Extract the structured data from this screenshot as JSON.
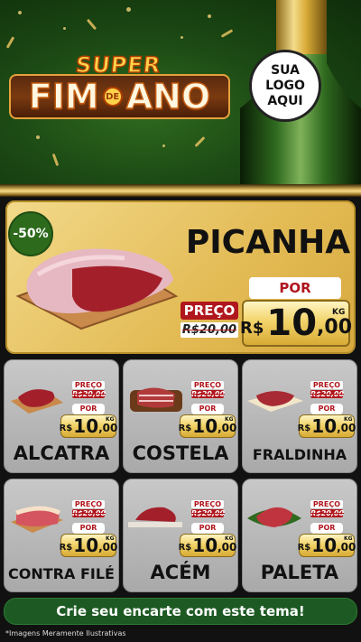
{
  "header": {
    "title_super": "SUPER",
    "title_fim": "FIM",
    "title_de": "DE",
    "title_ano": "ANO",
    "logo_lines": [
      "SUA",
      "LOGO",
      "AQUI"
    ]
  },
  "featured": {
    "discount": "-50%",
    "name": "PICANHA",
    "preco_label": "PREÇO",
    "old_price": "R$20,00",
    "por_label": "POR",
    "currency": "R$",
    "price_int": "10",
    "price_dec": ",00",
    "unit": "KG"
  },
  "products": [
    {
      "name": "ALCATRA",
      "preco_label": "PREÇO",
      "old_price": "R$20,00",
      "por_label": "POR",
      "currency": "R$",
      "price_int": "10",
      "price_dec": ",00",
      "unit": "KG"
    },
    {
      "name": "COSTELA",
      "preco_label": "PREÇO",
      "old_price": "R$20,00",
      "por_label": "POR",
      "currency": "R$",
      "price_int": "10",
      "price_dec": ",00",
      "unit": "KG"
    },
    {
      "name": "FRALDINHA",
      "preco_label": "PREÇO",
      "old_price": "R$20,00",
      "por_label": "POR",
      "currency": "R$",
      "price_int": "10",
      "price_dec": ",00",
      "unit": "KG"
    },
    {
      "name": "CONTRA FILÉ",
      "preco_label": "PREÇO",
      "old_price": "R$20,00",
      "por_label": "POR",
      "currency": "R$",
      "price_int": "10",
      "price_dec": ",00",
      "unit": "KG"
    },
    {
      "name": "ACÉM",
      "preco_label": "PREÇO",
      "old_price": "R$20,00",
      "por_label": "POR",
      "currency": "R$",
      "price_int": "10",
      "price_dec": ",00",
      "unit": "KG"
    },
    {
      "name": "PALETA",
      "preco_label": "PREÇO",
      "old_price": "R$20,00",
      "por_label": "POR",
      "currency": "R$",
      "price_int": "10",
      "price_dec": ",00",
      "unit": "KG"
    }
  ],
  "cta": "Crie seu encarte com este tema!",
  "footnote": "*Imagens Meramente Ilustrativas",
  "colors": {
    "green": "#1d5a23",
    "gold": "#e3bb55",
    "red": "#b0161d"
  }
}
